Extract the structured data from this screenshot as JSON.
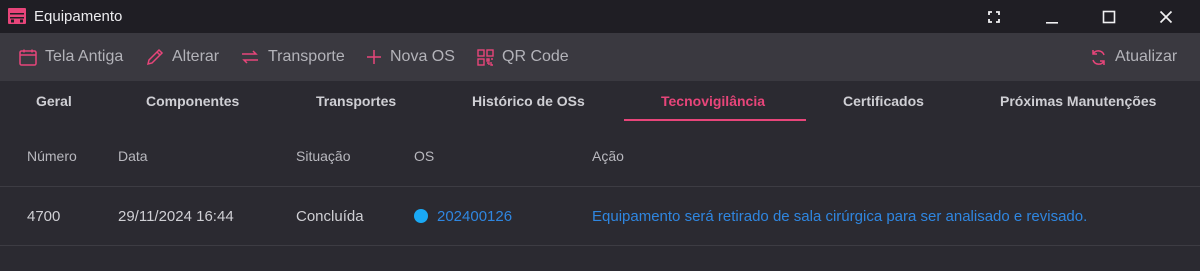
{
  "window": {
    "title": "Equipamento"
  },
  "toolbar": {
    "items": [
      {
        "label": "Tela Antiga",
        "icon": "calendar-icon"
      },
      {
        "label": "Alterar",
        "icon": "pencil-icon"
      },
      {
        "label": "Transporte",
        "icon": "swap-arrows-icon"
      },
      {
        "label": "Nova OS",
        "icon": "plus-icon"
      },
      {
        "label": "QR Code",
        "icon": "qr-code-icon"
      }
    ],
    "refresh_label": "Atualizar"
  },
  "tabs": [
    {
      "label": "Geral"
    },
    {
      "label": "Componentes"
    },
    {
      "label": "Transportes"
    },
    {
      "label": "Histórico de OSs"
    },
    {
      "label": "Tecnovigilância",
      "active": true
    },
    {
      "label": "Certificados"
    },
    {
      "label": "Próximas Manutenções"
    }
  ],
  "table": {
    "headers": [
      "Número",
      "Data",
      "Situação",
      "OS",
      "Ação"
    ],
    "rows": [
      {
        "numero": "4700",
        "data": "29/11/2024 16:44",
        "situacao": "Concluída",
        "os": "202400126",
        "acao": "Equipamento será retirado de sala cirúrgica para ser analisado e revisado."
      }
    ]
  },
  "colors": {
    "accent": "#e8457a",
    "link": "#2f86e0",
    "status_dot": "#1aa9f5",
    "titlebar_bg": "#1f1e24",
    "toolbar_bg": "#3a3940",
    "content_bg": "#2b2a31"
  }
}
